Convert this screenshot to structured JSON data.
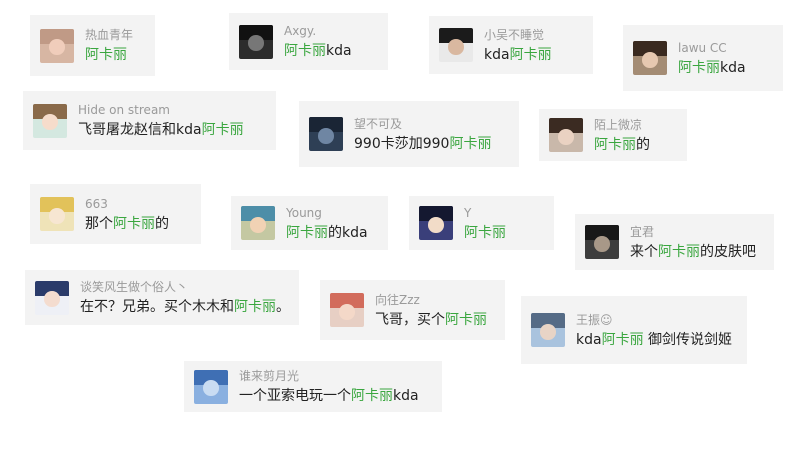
{
  "highlight_color": "#3aa63f",
  "comments": [
    {
      "name": "热血青年",
      "parts": [
        {
          "t": "阿卡丽",
          "hl": true
        }
      ],
      "avatar": {
        "bg": "#d7b6a3",
        "hair": "#c09a86",
        "face": "#f0cdbb"
      }
    },
    {
      "name": "Axgy.",
      "parts": [
        {
          "t": "阿卡丽",
          "hl": true
        },
        {
          "t": "kda",
          "hl": false
        }
      ],
      "avatar": {
        "bg": "#2c2c2c",
        "hair": "#111111",
        "face": "#777777"
      }
    },
    {
      "name": "小吴不睡觉",
      "parts": [
        {
          "t": "kda",
          "hl": false
        },
        {
          "t": "阿卡丽",
          "hl": true
        }
      ],
      "avatar": {
        "bg": "#e9e9e9",
        "hair": "#1b1b1b",
        "face": "#d9b8a0"
      }
    },
    {
      "name": "lawu CC",
      "parts": [
        {
          "t": "阿卡丽",
          "hl": true
        },
        {
          "t": "kda",
          "hl": false
        }
      ],
      "avatar": {
        "bg": "#a48c74",
        "hair": "#3a2a20",
        "face": "#e6c8b0"
      }
    },
    {
      "name": "Hide  on  stream",
      "parts": [
        {
          "t": "飞哥屠龙赵信和kda",
          "hl": false
        },
        {
          "t": "阿卡丽",
          "hl": true
        }
      ],
      "avatar": {
        "bg": "#d4e8e0",
        "hair": "#8a6a4a",
        "face": "#f6dccb"
      }
    },
    {
      "name": "望不可及",
      "parts": [
        {
          "t": "990卡莎加990",
          "hl": false
        },
        {
          "t": "阿卡丽",
          "hl": true
        }
      ],
      "avatar": {
        "bg": "#2e3f55",
        "hair": "#1a2535",
        "face": "#6f86a3"
      }
    },
    {
      "name": "陌上微凉",
      "parts": [
        {
          "t": "阿卡丽",
          "hl": true
        },
        {
          "t": "的",
          "hl": false
        }
      ],
      "avatar": {
        "bg": "#c9b8aa",
        "hair": "#3b2b22",
        "face": "#ead2c2"
      }
    },
    {
      "name": "663",
      "parts": [
        {
          "t": "那个",
          "hl": false
        },
        {
          "t": "阿卡丽",
          "hl": true
        },
        {
          "t": "的",
          "hl": false
        }
      ],
      "avatar": {
        "bg": "#efe3b8",
        "hair": "#e2c25a",
        "face": "#f7e6d2"
      }
    },
    {
      "name": "Young",
      "parts": [
        {
          "t": "阿卡丽",
          "hl": true
        },
        {
          "t": "的kda",
          "hl": false
        }
      ],
      "avatar": {
        "bg": "#c4c8a2",
        "hair": "#4d8ea8",
        "face": "#f1d2b4"
      }
    },
    {
      "name": "Y",
      "parts": [
        {
          "t": "阿卡丽",
          "hl": true
        }
      ],
      "avatar": {
        "bg": "#3a3f7a",
        "hair": "#141830",
        "face": "#f2dcc8"
      }
    },
    {
      "name": "宜君",
      "parts": [
        {
          "t": "来个",
          "hl": false
        },
        {
          "t": "阿卡丽",
          "hl": true
        },
        {
          "t": "的皮肤吧",
          "hl": false
        }
      ],
      "avatar": {
        "bg": "#3d3d3d",
        "hair": "#181818",
        "face": "#a89888"
      }
    },
    {
      "name": "谈笑风生做个俗人丶",
      "parts": [
        {
          "t": "在不？兄弟。买个木木和",
          "hl": false
        },
        {
          "t": "阿卡丽",
          "hl": true
        },
        {
          "t": "。",
          "hl": false
        }
      ],
      "avatar": {
        "bg": "#eef0f6",
        "hair": "#2a3b6a",
        "face": "#f4dccf"
      }
    },
    {
      "name": "向往Zzz",
      "parts": [
        {
          "t": "飞哥，买个",
          "hl": false
        },
        {
          "t": "阿卡丽",
          "hl": true
        }
      ],
      "avatar": {
        "bg": "#e7cfc4",
        "hair": "#d26c5c",
        "face": "#f4d8c8"
      }
    },
    {
      "name": "王振☺",
      "parts": [
        {
          "t": "kda",
          "hl": false
        },
        {
          "t": "阿卡丽",
          "hl": true
        },
        {
          "t": " 御剑传说剑姬",
          "hl": false
        }
      ],
      "avatar": {
        "bg": "#a9c3de",
        "hair": "#556b86",
        "face": "#e8d4c6"
      }
    },
    {
      "name": "谁来剪月光",
      "parts": [
        {
          "t": "一个亚索电玩一个",
          "hl": false
        },
        {
          "t": "阿卡丽",
          "hl": true
        },
        {
          "t": "kda",
          "hl": false
        }
      ],
      "avatar": {
        "bg": "#8ab0e0",
        "hair": "#3f6fb4",
        "face": "#c9dcf2"
      }
    }
  ]
}
